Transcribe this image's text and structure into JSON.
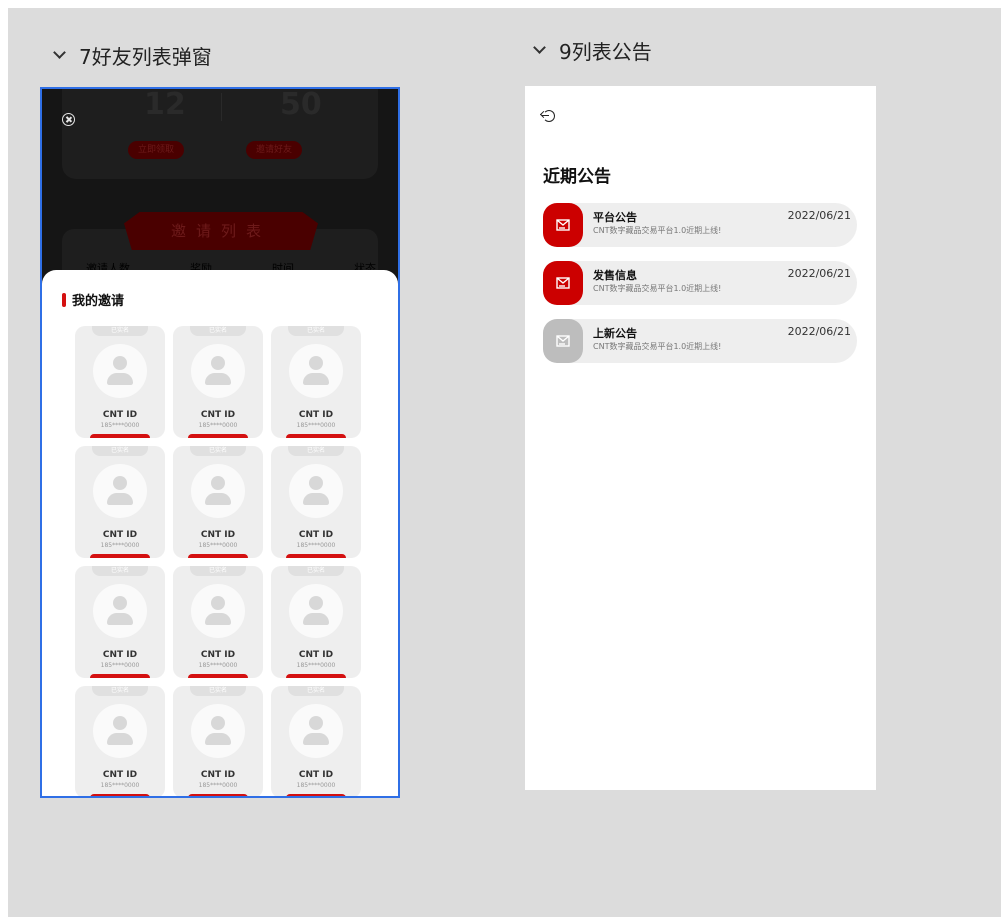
{
  "frames": {
    "friend_popup": {
      "title": "7好友列表弹窗"
    },
    "notice_list": {
      "title": "9列表公告"
    }
  },
  "friend_popup": {
    "stats": [
      {
        "value": "12",
        "button_label": "立即领取"
      },
      {
        "value": "50",
        "button_label": "邀请好友"
      }
    ],
    "invite_banner": "邀请列表",
    "column_headers": [
      "邀请人数",
      "奖励",
      "时间",
      "状态"
    ],
    "sheet_title": "我的邀请",
    "cards": [
      {
        "tag": "已实名",
        "name": "CNT ID",
        "phone": "185****0000"
      },
      {
        "tag": "已实名",
        "name": "CNT ID",
        "phone": "185****0000"
      },
      {
        "tag": "已实名",
        "name": "CNT ID",
        "phone": "185****0000"
      },
      {
        "tag": "已实名",
        "name": "CNT ID",
        "phone": "185****0000"
      },
      {
        "tag": "已实名",
        "name": "CNT ID",
        "phone": "185****0000"
      },
      {
        "tag": "已实名",
        "name": "CNT ID",
        "phone": "185****0000"
      },
      {
        "tag": "已实名",
        "name": "CNT ID",
        "phone": "185****0000"
      },
      {
        "tag": "已实名",
        "name": "CNT ID",
        "phone": "185****0000"
      },
      {
        "tag": "已实名",
        "name": "CNT ID",
        "phone": "185****0000"
      },
      {
        "tag": "已实名",
        "name": "CNT ID",
        "phone": "185****0000"
      },
      {
        "tag": "已实名",
        "name": "CNT ID",
        "phone": "185****0000"
      },
      {
        "tag": "已实名",
        "name": "CNT ID",
        "phone": "185****0000"
      }
    ],
    "accent": "#d41010"
  },
  "notice_list": {
    "heading": "近期公告",
    "items": [
      {
        "title": "平台公告",
        "date": "2022/06/21",
        "desc": "CNT数字藏品交易平台1.0近期上线!",
        "icon": "mail-icon",
        "icon_color": "#cc0000"
      },
      {
        "title": "发售信息",
        "date": "2022/06/21",
        "desc": "CNT数字藏品交易平台1.0近期上线!",
        "icon": "mail-icon",
        "icon_color": "#cc0000"
      },
      {
        "title": "上新公告",
        "date": "2022/06/21",
        "desc": "CNT数字藏品交易平台1.0近期上线!",
        "icon": "mail-icon",
        "icon_color": "#bdbdbd"
      }
    ]
  }
}
